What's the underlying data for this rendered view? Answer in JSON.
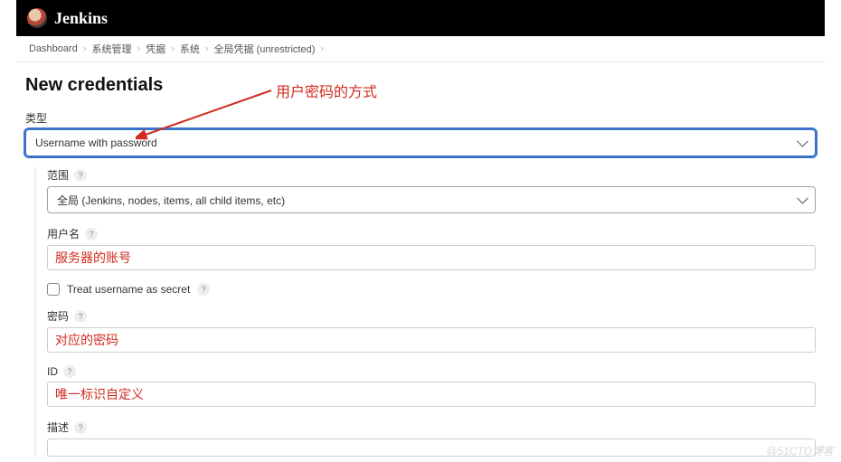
{
  "header": {
    "brand": "Jenkins"
  },
  "breadcrumbs": [
    "Dashboard",
    "系统管理",
    "凭据",
    "系统",
    "全局凭据 (unrestricted)"
  ],
  "page": {
    "title": "New credentials",
    "type_label": "类型",
    "type_value": "Username with password",
    "scope_label": "范围",
    "scope_value": "全局 (Jenkins, nodes, items, all child items, etc)",
    "username_label": "用户名",
    "username_value": "服务器的账号",
    "treat_secret_label": "Treat username as secret",
    "password_label": "密码",
    "password_value": "对应的密码",
    "id_label": "ID",
    "id_value": "唯一标识自定义",
    "desc_label": "描述"
  },
  "annotation": {
    "top_note": "用户密码的方式"
  },
  "watermark": "@51CTO博客"
}
